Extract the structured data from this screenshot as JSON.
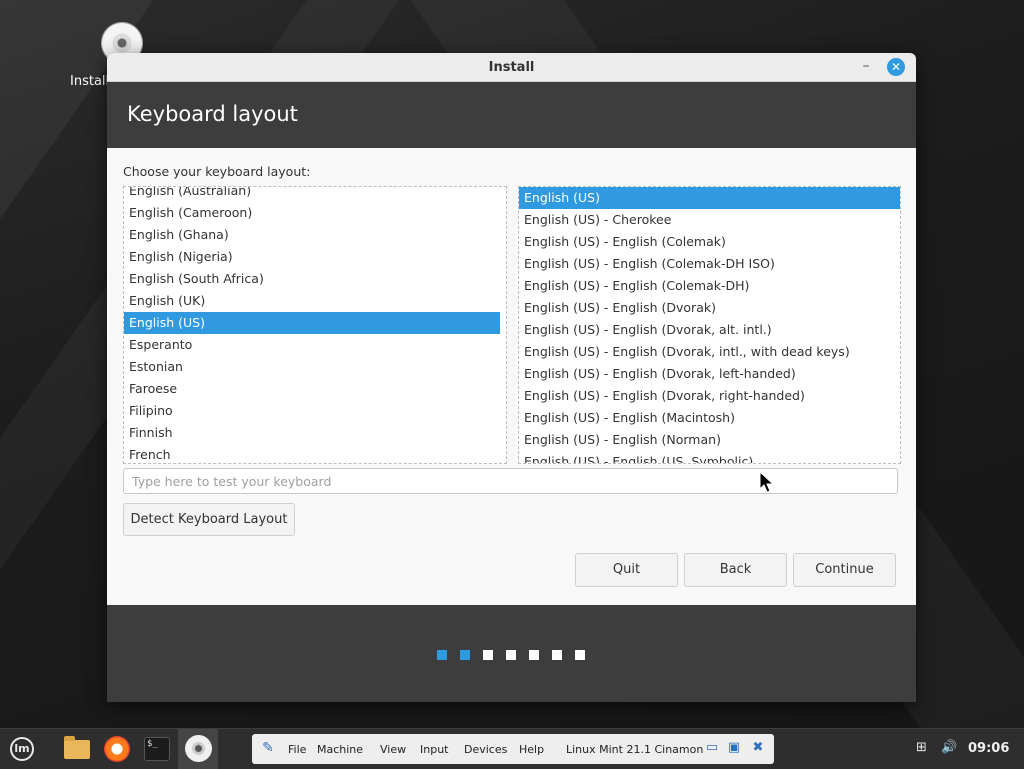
{
  "desktop": {
    "icon_label": "Install"
  },
  "window": {
    "title": "Install",
    "minimize_glyph": "–",
    "close_glyph": "✕"
  },
  "header": {
    "title": "Keyboard layout"
  },
  "content": {
    "prompt": "Choose your keyboard layout:",
    "layouts": [
      {
        "label": "English (Australian)",
        "selected": false
      },
      {
        "label": "English (Cameroon)",
        "selected": false
      },
      {
        "label": "English (Ghana)",
        "selected": false
      },
      {
        "label": "English (Nigeria)",
        "selected": false
      },
      {
        "label": "English (South Africa)",
        "selected": false
      },
      {
        "label": "English (UK)",
        "selected": false
      },
      {
        "label": "English (US)",
        "selected": true
      },
      {
        "label": "Esperanto",
        "selected": false
      },
      {
        "label": "Estonian",
        "selected": false
      },
      {
        "label": "Faroese",
        "selected": false
      },
      {
        "label": "Filipino",
        "selected": false
      },
      {
        "label": "Finnish",
        "selected": false
      },
      {
        "label": "French",
        "selected": false
      }
    ],
    "variants": [
      {
        "label": "English (US)",
        "selected": true
      },
      {
        "label": "English (US) - Cherokee",
        "selected": false
      },
      {
        "label": "English (US) - English (Colemak)",
        "selected": false
      },
      {
        "label": "English (US) - English (Colemak-DH ISO)",
        "selected": false
      },
      {
        "label": "English (US) - English (Colemak-DH)",
        "selected": false
      },
      {
        "label": "English (US) - English (Dvorak)",
        "selected": false
      },
      {
        "label": "English (US) - English (Dvorak, alt. intl.)",
        "selected": false
      },
      {
        "label": "English (US) - English (Dvorak, intl., with dead keys)",
        "selected": false
      },
      {
        "label": "English (US) - English (Dvorak, left-handed)",
        "selected": false
      },
      {
        "label": "English (US) - English (Dvorak, right-handed)",
        "selected": false
      },
      {
        "label": "English (US) - English (Macintosh)",
        "selected": false
      },
      {
        "label": "English (US) - English (Norman)",
        "selected": false
      },
      {
        "label": "English (US) - English (US, Symbolic)",
        "selected": false
      }
    ],
    "test_input": {
      "value": "",
      "placeholder": "Type here to test your keyboard"
    },
    "detect_button": "Detect Keyboard Layout"
  },
  "buttons": {
    "quit": "Quit",
    "back": "Back",
    "continue": "Continue"
  },
  "progress": {
    "total_steps": 7,
    "completed_steps": 2
  },
  "taskbar": {
    "vbox_menu": [
      "File",
      "Machine",
      "View",
      "Input",
      "Devices",
      "Help"
    ],
    "vbox_status": "Linux Mint 21.1 Cinamon",
    "clock": "09:06"
  },
  "colors": {
    "accent": "#2f9ae0",
    "header_bg": "#3d3d3d",
    "content_bg": "#f8f8f8"
  }
}
